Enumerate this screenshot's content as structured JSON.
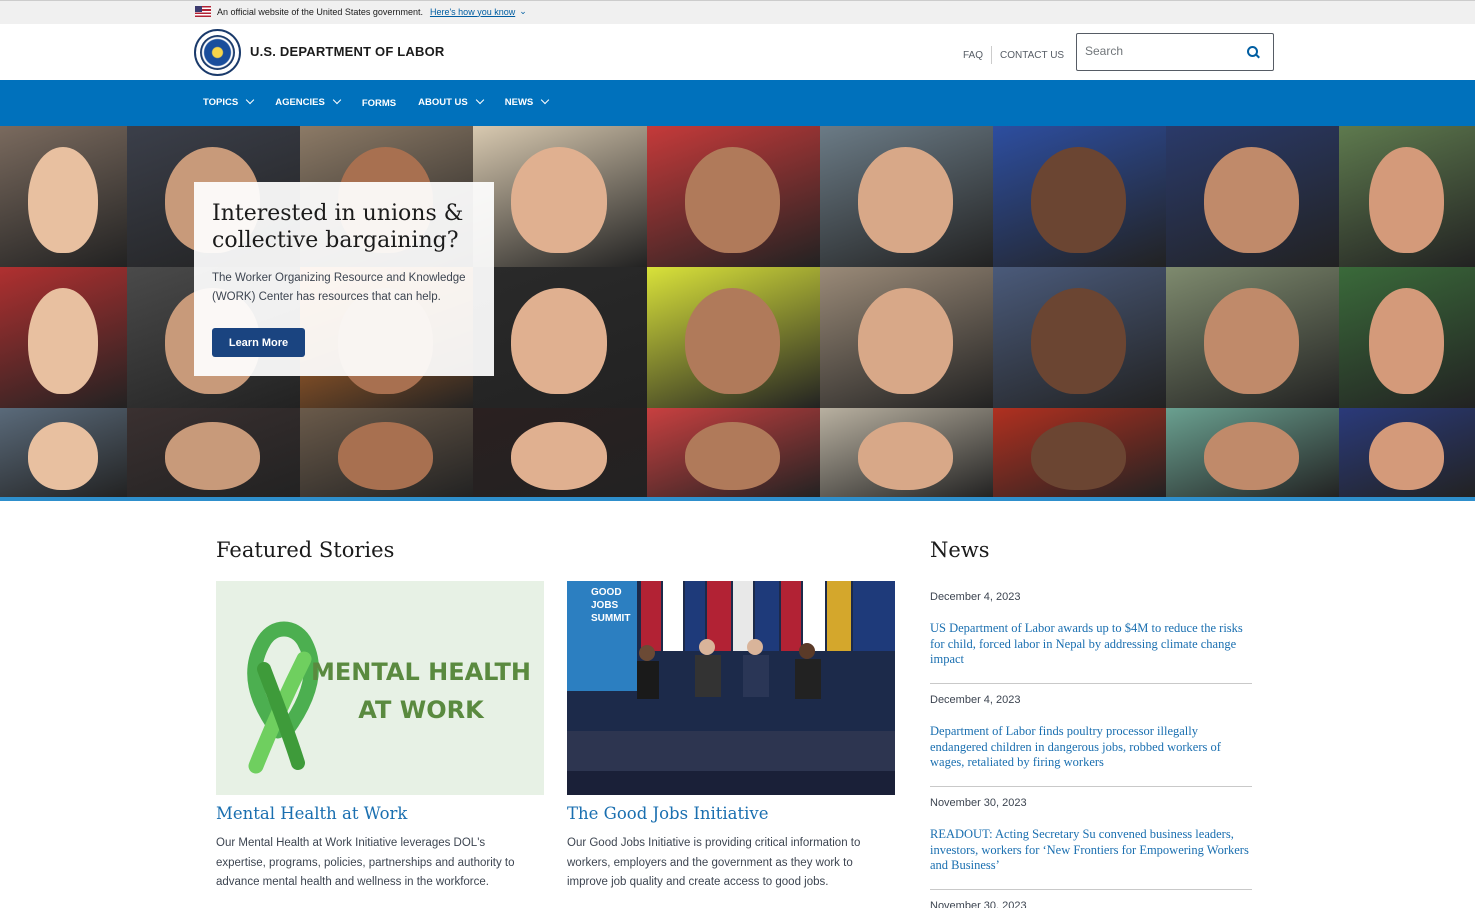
{
  "gov_banner": {
    "text": "An official website of the United States government.",
    "link": "Here's how you know"
  },
  "header": {
    "site_title": "U.S. DEPARTMENT OF LABOR",
    "faq": "FAQ",
    "contact": "CONTACT US",
    "search_placeholder": "Search"
  },
  "nav": {
    "items": [
      {
        "label": "TOPICS"
      },
      {
        "label": "AGENCIES"
      },
      {
        "label": "FORMS"
      },
      {
        "label": "ABOUT US"
      },
      {
        "label": "NEWS"
      }
    ]
  },
  "hero": {
    "title": "Interested in unions & collective bargaining?",
    "text": "The Worker Organizing Resource and Knowledge (WORK) Center has resources that can help.",
    "button": "Learn More"
  },
  "featured": {
    "title": "Featured Stories",
    "stories": [
      {
        "image_text": "MENTAL HEALTH AT WORK",
        "title": "Mental Health at Work",
        "text": "Our Mental Health at Work Initiative leverages DOL's expertise, programs, policies, partnerships and authority to advance mental health and wellness in the workforce."
      },
      {
        "image_text": "GOOD JOBS SUMMIT",
        "title": "The Good Jobs Initiative",
        "text": "Our Good Jobs Initiative is providing critical information to workers, employers and the government as they work to improve job quality and create access to good jobs."
      }
    ]
  },
  "news": {
    "title": "News",
    "items": [
      {
        "date": "December 4, 2023",
        "headline": "US Department of Labor awards up to $4M to reduce the risks for child, forced labor in Nepal by addressing climate change impact"
      },
      {
        "date": "December 4, 2023",
        "headline": "Department of Labor finds poultry processor illegally endangered children in dangerous jobs, robbed workers of wages, retaliated by firing workers"
      },
      {
        "date": "November 30, 2023",
        "headline": "READOUT: Acting Secretary Su convened business leaders, investors, workers for ‘New Frontiers for Empowering Workers and Business’"
      },
      {
        "date": "November 30, 2023",
        "headline": ""
      }
    ]
  },
  "colors": {
    "nav_bg": "#0071bc",
    "link": "#1a6fb0",
    "button": "#1a4480",
    "hero_border": "#2e8fcc"
  }
}
